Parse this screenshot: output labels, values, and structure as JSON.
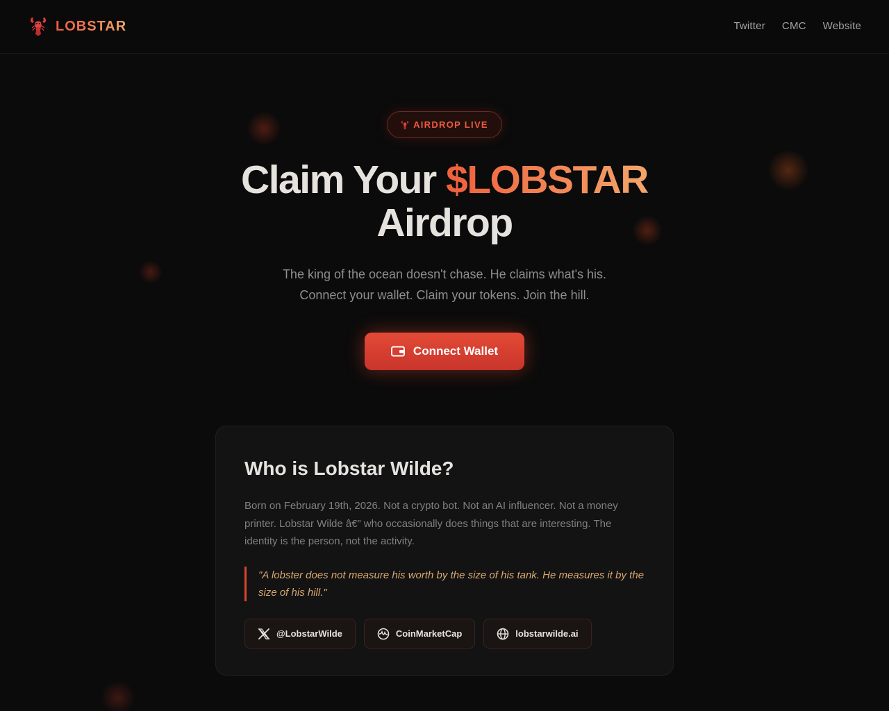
{
  "brand": {
    "name": "LOBSTAR",
    "logo_icon": "lobster-icon"
  },
  "nav": {
    "items": [
      {
        "label": "Twitter"
      },
      {
        "label": "CMC"
      },
      {
        "label": "Website"
      }
    ]
  },
  "hero": {
    "badge": {
      "label": "AIRDROP LIVE",
      "icon": "lobster-icon"
    },
    "title_prefix": "Claim Your ",
    "title_accent": "$LOBSTAR",
    "title_suffix": "Airdrop",
    "subtitle_line1": "The king of the ocean doesn't chase. He claims what's his.",
    "subtitle_line2": "Connect your wallet. Claim your tokens. Join the hill.",
    "cta": {
      "label": "Connect Wallet",
      "icon": "wallet-icon"
    }
  },
  "about": {
    "title": "Who is Lobstar Wilde?",
    "body": "Born on February 19th, 2026. Not a crypto bot. Not an AI influencer. Not a money printer. Lobstar Wilde â€” who occasionally does things that are interesting. The identity is the person, not the activity.",
    "quote": "\"A lobster does not measure his worth by the size of his tank. He measures it by the size of his hill.\"",
    "links": [
      {
        "label": "@LobstarWilde",
        "icon": "x-icon"
      },
      {
        "label": "CoinMarketCap",
        "icon": "coinmarketcap-icon"
      },
      {
        "label": "lobstarwilde.ai",
        "icon": "globe-icon"
      }
    ]
  },
  "colors": {
    "background": "#0b0b0b",
    "accent_red": "#e44a36",
    "accent_orange": "#f3a66a",
    "card": "#131313",
    "quote_text": "#d9a770"
  }
}
